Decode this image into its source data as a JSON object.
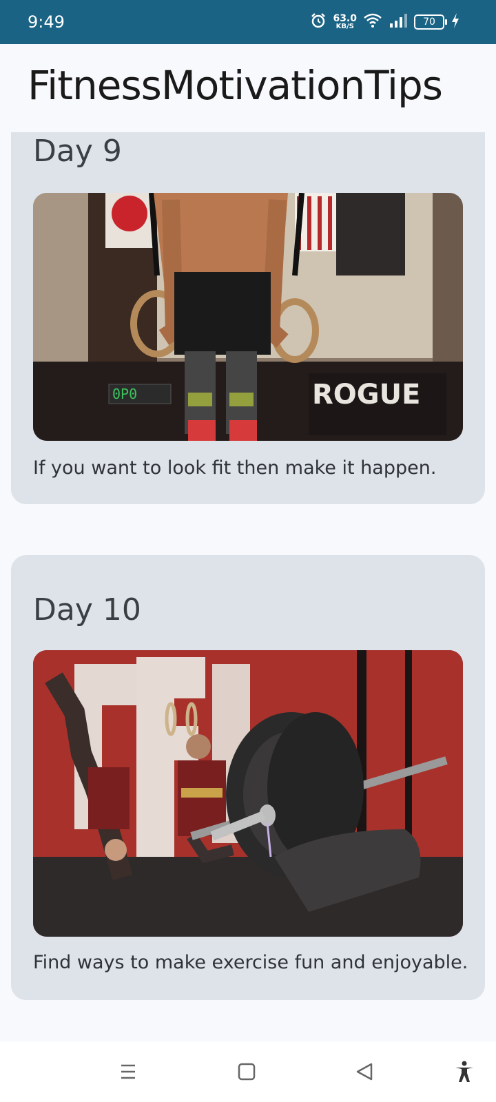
{
  "status_bar": {
    "time": "9:49",
    "net_speed_value": "63.0",
    "net_speed_unit": "KB/S",
    "battery_level": "70",
    "icons": [
      "alarm-icon",
      "wifi-icon",
      "signal-icon",
      "battery-icon",
      "charging-icon"
    ]
  },
  "app": {
    "title": "FitnessMotivationTips"
  },
  "cards": [
    {
      "day": "Day 9",
      "caption": "If you want to look fit then make it happen.",
      "photo_overlay": {
        "sign": "ROGUE",
        "score_box": "0P0"
      }
    },
    {
      "day": "Day 10",
      "caption": "Find ways to make exercise fun and enjoyable."
    }
  ],
  "nav_bar": {
    "buttons": [
      "menu-icon",
      "home-icon",
      "back-icon",
      "accessibility-icon"
    ]
  },
  "colors": {
    "status_bar": "#1b6384",
    "card_bg": "#dee3ea",
    "page_bg": "#f7f9fc"
  }
}
